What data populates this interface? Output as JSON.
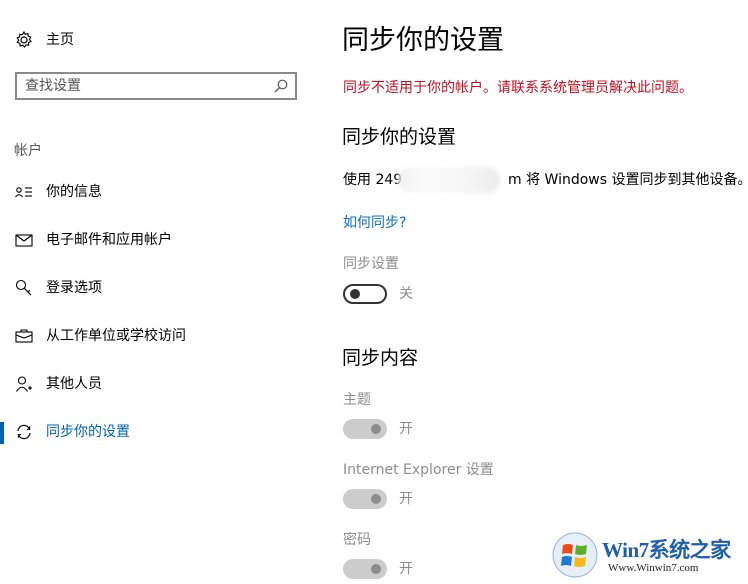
{
  "sidebar": {
    "home": {
      "label": "主页",
      "icon": "gear-icon"
    },
    "search": {
      "placeholder": "查找设置",
      "icon": "search-icon"
    },
    "section": "帐户",
    "items": [
      {
        "label": "你的信息",
        "icon": "person-card-icon"
      },
      {
        "label": "电子邮件和应用帐户",
        "icon": "mail-icon"
      },
      {
        "label": "登录选项",
        "icon": "key-icon"
      },
      {
        "label": "从工作单位或学校访问",
        "icon": "briefcase-icon"
      },
      {
        "label": "其他人员",
        "icon": "person-icon"
      },
      {
        "label": "同步你的设置",
        "icon": "sync-icon",
        "active": true
      }
    ]
  },
  "main": {
    "title": "同步你的设置",
    "error": "同步不适用于你的帐户。请联系系统管理员解决此问题。",
    "subtitle": "同步你的设置",
    "desc_prefix": "使用 249",
    "desc_suffix": "m 将 Windows 设置同步到其他设备。",
    "how_link": "如何同步?",
    "sync_setting": {
      "label": "同步设置",
      "state": "关"
    },
    "content_title": "同步内容",
    "items": [
      {
        "label": "主题",
        "state": "开"
      },
      {
        "label": "Internet Explorer 设置",
        "state": "开"
      },
      {
        "label": "密码",
        "state": "开"
      }
    ]
  },
  "watermark": {
    "brand": "Win7系统之家",
    "url": "Www.Winwin7.com"
  },
  "colors": {
    "accent": "#0063b1",
    "error": "#c50f1f",
    "link": "#0a70c1",
    "disabled": "#8c8c8c"
  }
}
